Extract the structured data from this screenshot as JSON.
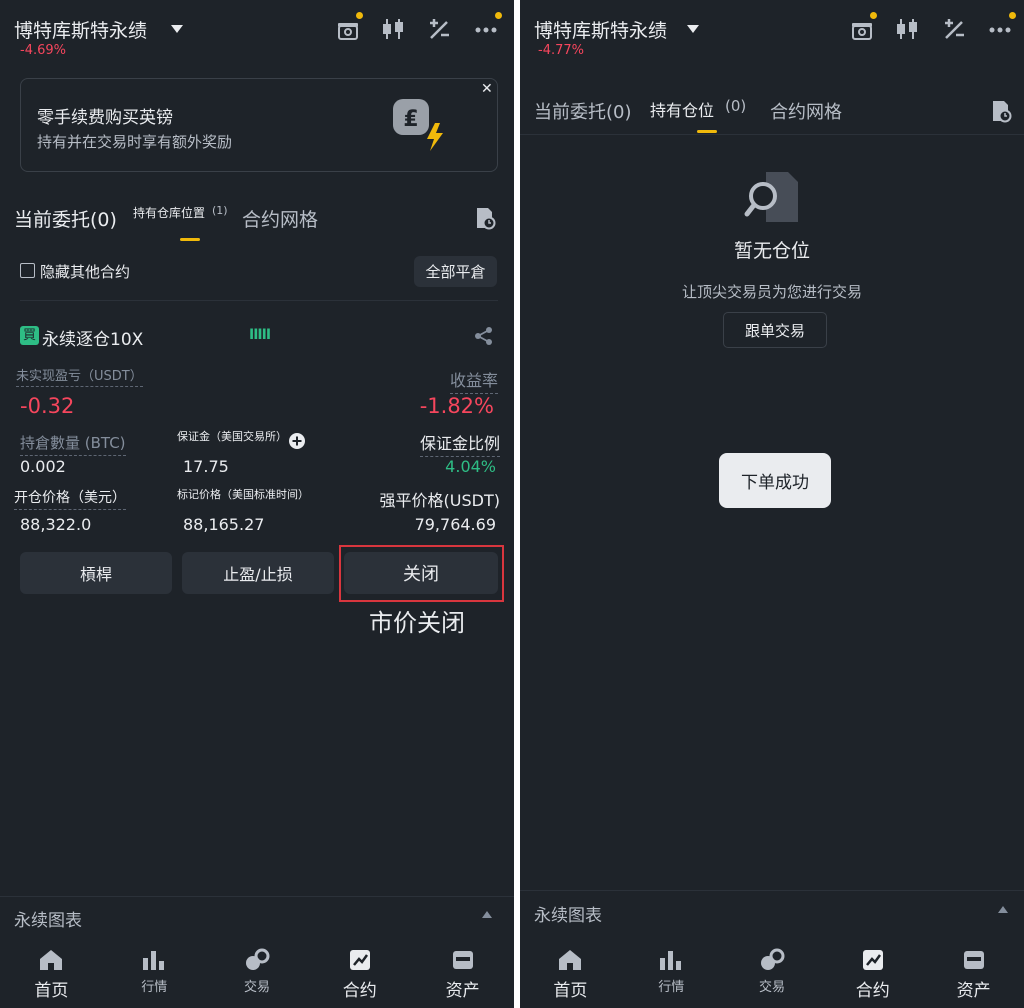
{
  "left": {
    "header": {
      "title": "博特库斯特永绩",
      "change": "-4.69%"
    },
    "promo": {
      "title": "零手续费购买英镑",
      "subtitle": "持有并在交易时享有额外奖励"
    },
    "tabs": [
      "当前委托(0)",
      "持有仓库位置",
      "(1)",
      "合约网格"
    ],
    "hide_other_label": "隐藏其他合约",
    "close_all_label": "全部平倉",
    "position": {
      "badge": "買",
      "name": "永续逐仓10X",
      "bars": "IIIII",
      "pnl_label": "未实现盈亏（USDT）",
      "pnl_value": "-0.32",
      "roe_label": "收益率",
      "roe_value": "-1.82%",
      "qty_label": "持倉數量 (BTC)",
      "qty_value": "0.002",
      "margin_label": "保证金（美国交易所）",
      "margin_value": "17.75",
      "margin_ratio_label": "保证金比例",
      "margin_ratio_value": "4.04%",
      "entry_label": "开仓价格（美元）",
      "entry_value": "88,322.0",
      "mark_label": "标记价格（美国标准时间）",
      "mark_value": "88,165.27",
      "liq_label": "强平价格(USDT)",
      "liq_value": "79,764.69"
    },
    "buttons": {
      "leverage": "槓桿",
      "tpsl": "止盈/止损",
      "close": "关闭"
    },
    "annotation": "市价关闭",
    "footer_label": "永续图表"
  },
  "right": {
    "header": {
      "title": "博特库斯特永绩",
      "change": "-4.77%"
    },
    "tabs": [
      "当前委托(0)",
      "持有仓位",
      "(0)",
      "合约网格"
    ],
    "empty_title": "暂无仓位",
    "empty_subtitle": "让顶尖交易员为您进行交易",
    "copy_trade_label": "跟单交易",
    "toast": "下单成功",
    "footer_label": "永续图表"
  },
  "nav": [
    {
      "label": "首页",
      "icon": "home-icon"
    },
    {
      "label": "行情",
      "icon": "markets-icon"
    },
    {
      "label": "交易",
      "icon": "trade-icon"
    },
    {
      "label": "合约",
      "icon": "futures-icon"
    },
    {
      "label": "资产",
      "icon": "wallet-icon"
    }
  ],
  "colors": {
    "accent": "#f0b90b",
    "negative": "#f6465d",
    "positive": "#2ebd85",
    "background": "#1e2329",
    "highlight_box": "#d9363e"
  }
}
